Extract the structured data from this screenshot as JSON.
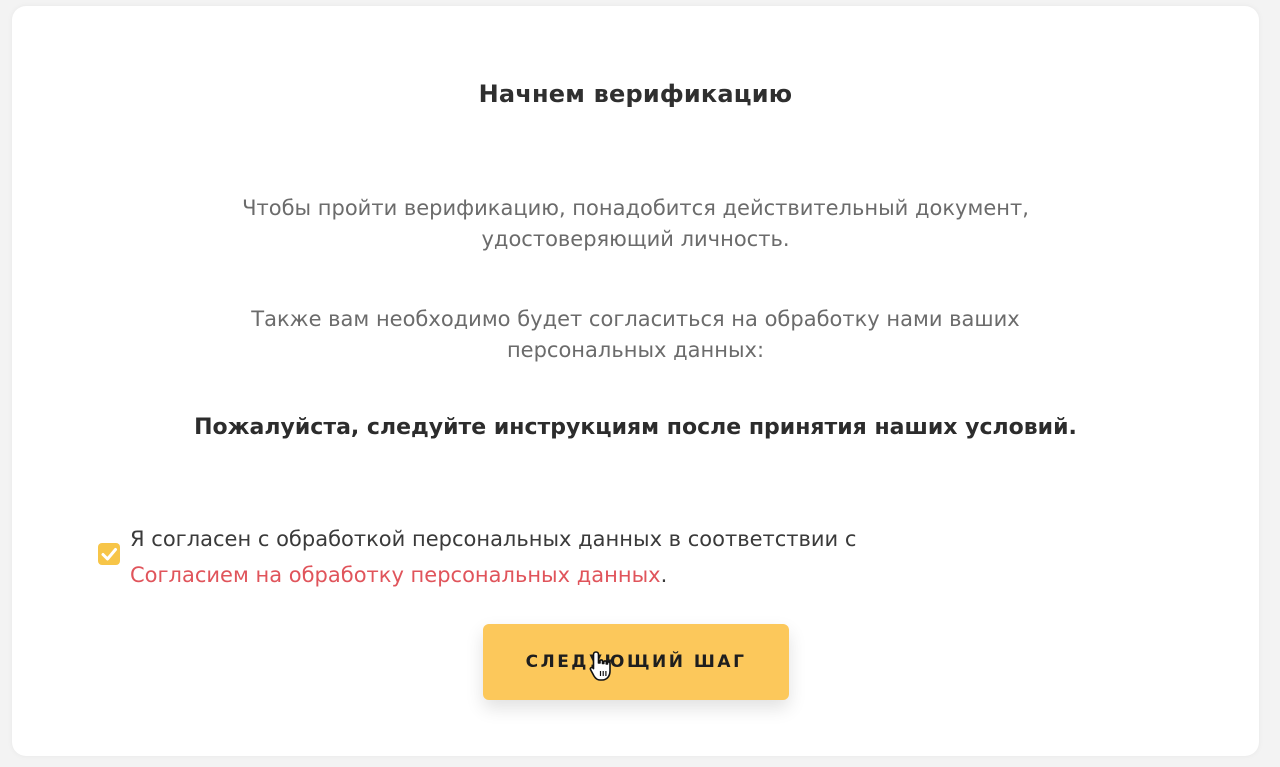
{
  "verification": {
    "title": "Начнем верификацию",
    "paragraph1_line1": "Чтобы пройти верификацию, понадобится действительный документ,",
    "paragraph1_line2": "удостоверяющий личность.",
    "paragraph2_line1": "Также вам необходимо будет согласиться на обработку нами ваших",
    "paragraph2_line2": "персональных данных:",
    "instruction": "Пожалуйста, следуйте инструкциям после принятия наших условий."
  },
  "consent": {
    "checked": true,
    "text_before": "Я согласен с обработкой персональных данных в соответствии с",
    "link_text": "Согласием на обработку персональных данных",
    "text_after": "."
  },
  "actions": {
    "next_label": "СЛЕДУЮЩИЙ ШАГ"
  },
  "colors": {
    "accent": "#fcc85b",
    "link": "#e0545b"
  },
  "icons": {
    "checkbox": "check-icon",
    "cursor": "hand-pointer-icon"
  }
}
